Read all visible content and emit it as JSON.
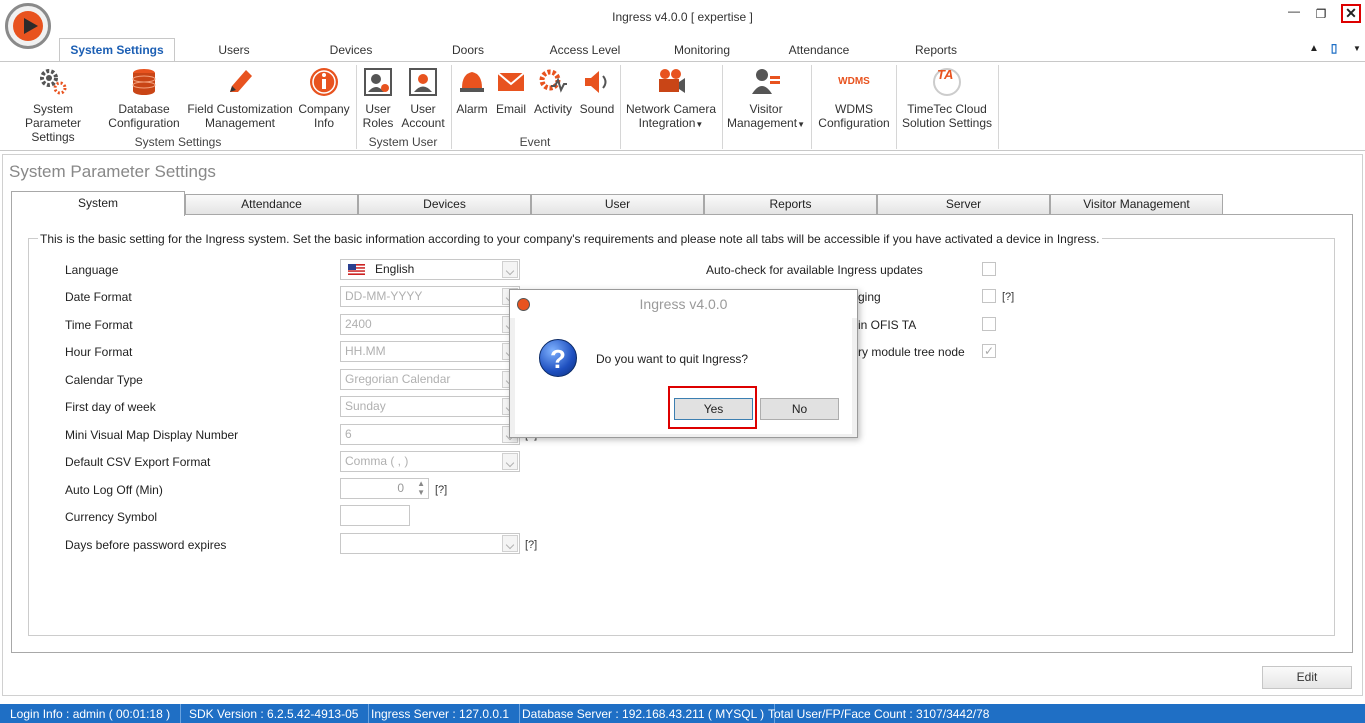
{
  "window": {
    "title": "Ingress v4.0.0 [ expertise ]",
    "minimize_icon": "minimize-icon",
    "restore_icon": "restore-icon",
    "close_icon": "close-icon"
  },
  "ribbon_tabs": [
    "System Settings",
    "Users",
    "Devices",
    "Doors",
    "Access Level",
    "Monitoring",
    "Attendance",
    "Reports"
  ],
  "ribbon": {
    "buttons": [
      {
        "line1": "System Parameter",
        "line2": "Settings",
        "icon": "gears-icon"
      },
      {
        "line1": "Database",
        "line2": "Configuration",
        "icon": "database-icon"
      },
      {
        "line1": "Field Customization",
        "line2": "Management",
        "icon": "pencil-icon"
      },
      {
        "line1": "Company",
        "line2": "Info",
        "icon": "info-icon"
      },
      {
        "line1": "User",
        "line2": "Roles",
        "icon": "user-roles-icon"
      },
      {
        "line1": "User",
        "line2": "Account",
        "icon": "user-account-icon"
      },
      {
        "line1": "Alarm",
        "line2": "",
        "icon": "alarm-icon"
      },
      {
        "line1": "Email",
        "line2": "",
        "icon": "email-icon"
      },
      {
        "line1": "Activity",
        "line2": "",
        "icon": "activity-icon"
      },
      {
        "line1": "Sound",
        "line2": "",
        "icon": "sound-icon"
      },
      {
        "line1": "Network Camera",
        "line2": "Integration",
        "icon": "camera-icon"
      },
      {
        "line1": "Visitor",
        "line2": "Management",
        "icon": "visitor-icon"
      },
      {
        "line1": "WDMS",
        "line2": "Configuration",
        "icon": "wdms-icon"
      },
      {
        "line1": "TimeTec Cloud",
        "line2": "Solution Settings",
        "icon": "timetec-icon"
      }
    ],
    "groups": [
      "System Settings",
      "System User",
      "Event"
    ],
    "wdms_logo_text": "WDMS",
    "ta_logo_text": "TA"
  },
  "page_title": "System Parameter Settings",
  "tabs": [
    "System",
    "Attendance",
    "Devices",
    "User",
    "Reports",
    "Server",
    "Visitor Management"
  ],
  "description": "This is the basic setting for the Ingress system. Set the basic information according to your company's requirements and please note all tabs will be accessible if you have activated a device in Ingress.",
  "fields": [
    {
      "label": "Language",
      "value": "English"
    },
    {
      "label": "Date Format",
      "value": "DD-MM-YYYY"
    },
    {
      "label": "Time Format",
      "value": "2400"
    },
    {
      "label": "Hour Format",
      "value": "HH.MM"
    },
    {
      "label": "Calendar Type",
      "value": "Gregorian Calendar"
    },
    {
      "label": "First day of week",
      "value": "Sunday"
    },
    {
      "label": "Mini Visual Map Display Number",
      "value": "6"
    },
    {
      "label": "Default CSV Export Format",
      "value": "Comma ( , )"
    },
    {
      "label": "Auto Log Off (Min)",
      "value": "0"
    },
    {
      "label": "Currency Symbol",
      "value": ""
    },
    {
      "label": "Days before password expires",
      "value": ""
    }
  ],
  "help_hint": "[?]",
  "right_options": [
    {
      "label": "Auto-check for available Ingress updates",
      "checked": false
    },
    {
      "label": "ging",
      "checked": false
    },
    {
      "label": "in OFIS TA",
      "checked": false
    },
    {
      "label": "ry module tree node",
      "checked": true
    }
  ],
  "dialog": {
    "title": "Ingress v4.0.0",
    "message": "Do you want to quit Ingress?",
    "yes": "Yes",
    "no": "No",
    "question_mark": "?"
  },
  "edit_label": "Edit",
  "status": [
    "Login Info : admin ( 00:01:18 )",
    "SDK Version : 6.2.5.42-4913-05",
    "Ingress Server : 127.0.0.1",
    "Database Server : 192.168.43.211 ( MYSQL )",
    "Total User/FP/Face Count : 3107/3442/78"
  ],
  "colors": {
    "accent": "#1f6fc5",
    "highlight": "#dd0000",
    "brand_orange": "#e8531f"
  }
}
